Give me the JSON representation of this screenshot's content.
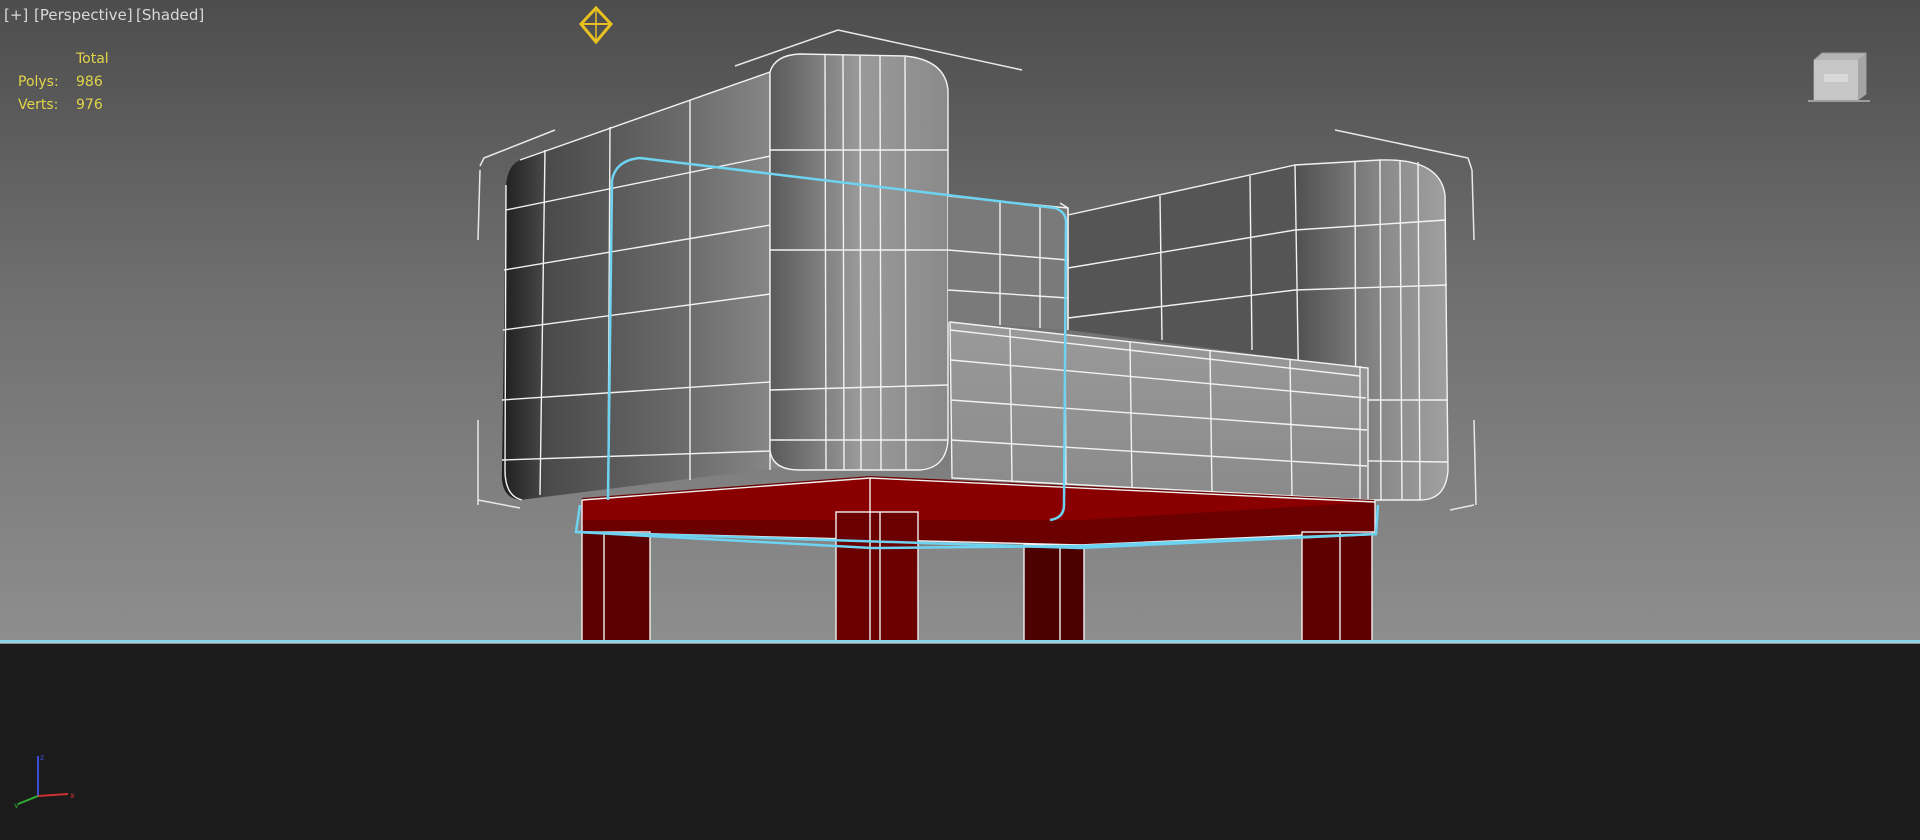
{
  "viewport": {
    "labels": {
      "plus": "[+]",
      "view": "[Perspective]",
      "mode": "[Shaded]"
    },
    "stats": {
      "header": "Total",
      "polys_label": "Polys:",
      "polys_value": "986",
      "verts_label": "Verts:",
      "verts_value": "976"
    }
  },
  "colors": {
    "wireframe": "#f2f2f2",
    "selection": "#6ed3f0",
    "frame_red": "#6a0000",
    "gizmo_yellow": "#e8c020",
    "stats_text": "#e2d44a"
  },
  "icons": {
    "light": "light-gizmo-icon",
    "viewcube": "viewcube-icon",
    "axis": "axis-tripod-icon"
  }
}
